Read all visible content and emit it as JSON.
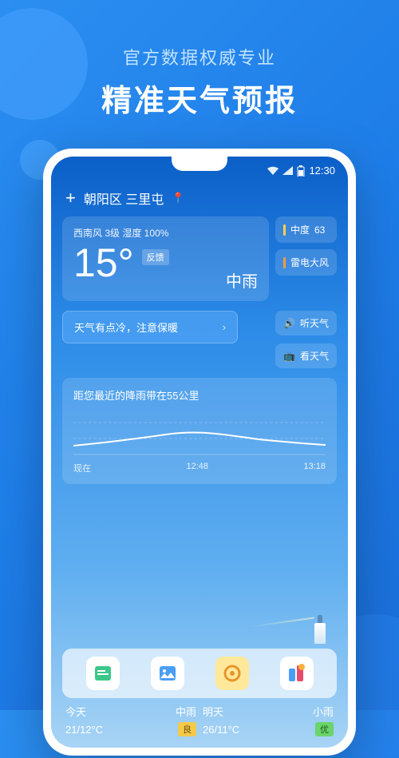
{
  "promo": {
    "title": "官方数据权威专业",
    "subtitle": "精准天气预报"
  },
  "status": {
    "time": "12:30"
  },
  "location": {
    "plus": "+",
    "text": "朝阳区 三里屯"
  },
  "weather": {
    "wind_humidity": "西南风 3级 湿度 100%",
    "temp": "15°",
    "feedback": "反馈",
    "condition": "中雨"
  },
  "side_badges": [
    {
      "label": "中度",
      "value": "63"
    },
    {
      "label": "雷电大风",
      "value": ""
    }
  ],
  "tip": {
    "text": "天气有点冷，注意保暖"
  },
  "actions": {
    "listen": "听天气",
    "watch": "看天气"
  },
  "rain": {
    "title": "距您最近的降雨带在55公里",
    "times": [
      "现在",
      "12:48",
      "13:18"
    ]
  },
  "forecast": [
    {
      "day": "今天",
      "cond": "中雨",
      "range": "21/12°C",
      "aqi": "良",
      "aqi_class": "good"
    },
    {
      "day": "明天",
      "cond": "小雨",
      "range": "26/11°C",
      "aqi": "优",
      "aqi_class": "exc"
    }
  ],
  "chart_data": {
    "type": "line",
    "title": "距您最近的降雨带在55公里",
    "x": [
      "现在",
      "12:48",
      "13:18"
    ],
    "series": [
      {
        "name": "precipitation-proximity",
        "values": [
          0.25,
          0.4,
          0.45,
          0.55,
          0.45,
          0.35,
          0.3
        ]
      }
    ],
    "ylim": [
      0,
      1
    ],
    "xlabel": "",
    "ylabel": ""
  }
}
